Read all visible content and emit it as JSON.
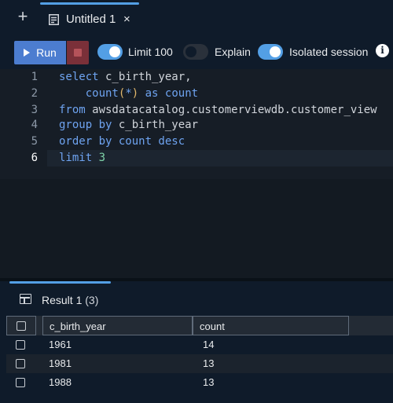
{
  "tabs": {
    "add_icon": "plus-icon",
    "active": {
      "label": "Untitled 1",
      "close_glyph": "×"
    }
  },
  "toolbar": {
    "run_label": "Run",
    "toggles": [
      {
        "label": "Limit 100",
        "on": true
      },
      {
        "label": "Explain",
        "on": false
      },
      {
        "label": "Isolated session",
        "on": true
      }
    ],
    "info_glyph": "i"
  },
  "editor": {
    "line_numbers": [
      "1",
      "2",
      "3",
      "4",
      "5",
      "6"
    ],
    "active_line": 6,
    "lines": [
      [
        {
          "t": "select",
          "c": "kw"
        },
        {
          "t": " c_birth_year,",
          "c": ""
        }
      ],
      [
        {
          "t": "    ",
          "c": ""
        },
        {
          "t": "count",
          "c": "kw"
        },
        {
          "t": "(",
          "c": "punc"
        },
        {
          "t": "*",
          "c": "kw"
        },
        {
          "t": ")",
          "c": "punc"
        },
        {
          "t": " as ",
          "c": "kw"
        },
        {
          "t": "count",
          "c": "kw"
        }
      ],
      [
        {
          "t": "from",
          "c": "kw"
        },
        {
          "t": " awsdatacatalog.customerviewdb.customer_view",
          "c": ""
        }
      ],
      [
        {
          "t": "group by",
          "c": "kw"
        },
        {
          "t": " c_birth_year",
          "c": ""
        }
      ],
      [
        {
          "t": "order by count desc",
          "c": "kw"
        }
      ],
      [
        {
          "t": "limit ",
          "c": "kw"
        },
        {
          "t": "3",
          "c": "num"
        }
      ]
    ]
  },
  "results": {
    "tab_label": "Result 1",
    "tab_count": "(3)",
    "columns": [
      "c_birth_year",
      "count"
    ],
    "rows": [
      [
        "1961",
        "14"
      ],
      [
        "1981",
        "13"
      ],
      [
        "1988",
        "13"
      ]
    ]
  },
  "colors": {
    "accent": "#539fe5",
    "run": "#4c7dd0",
    "stop": "#7a3039",
    "keyword": "#6ea3f0",
    "number": "#7fd4a9"
  }
}
